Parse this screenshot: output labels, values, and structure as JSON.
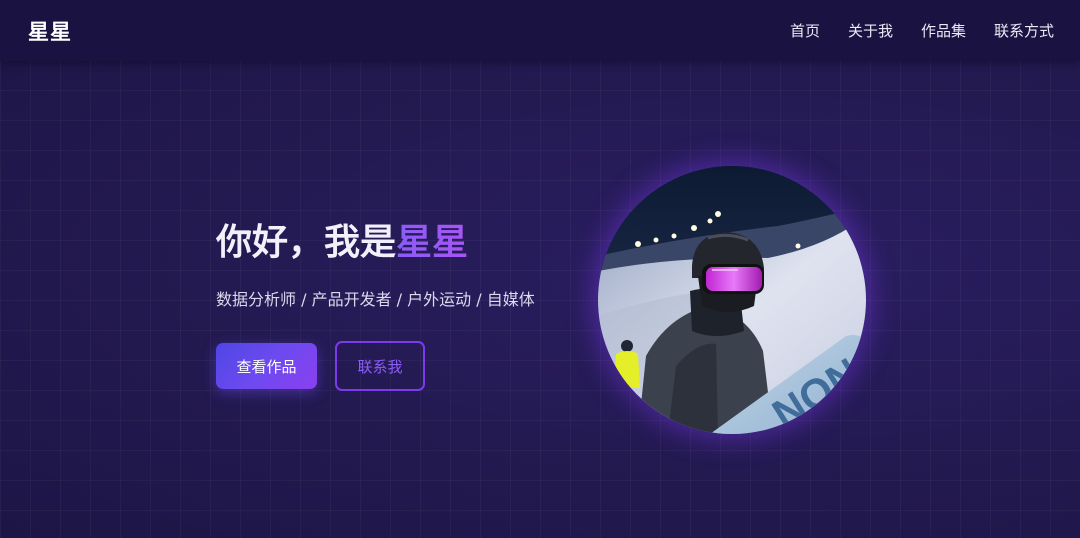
{
  "header": {
    "logo": "星星",
    "nav": [
      {
        "label": "首页"
      },
      {
        "label": "关于我"
      },
      {
        "label": "作品集"
      },
      {
        "label": "联系方式"
      }
    ]
  },
  "hero": {
    "title_prefix": "你好，我是",
    "title_name": "星星",
    "subtitle": "数据分析师 / 产品开发者 / 户外运动 / 自媒体",
    "primary_button": "查看作品",
    "secondary_button": "联系我"
  },
  "colors": {
    "background": "#22194f",
    "navbar": "#1a1240",
    "accent": "#8b5cf6",
    "button_gradient_start": "#4f46e5",
    "button_gradient_end": "#8b3ff0"
  },
  "avatar": {
    "icon": "snowboarder-photo",
    "board_text": "NON"
  }
}
